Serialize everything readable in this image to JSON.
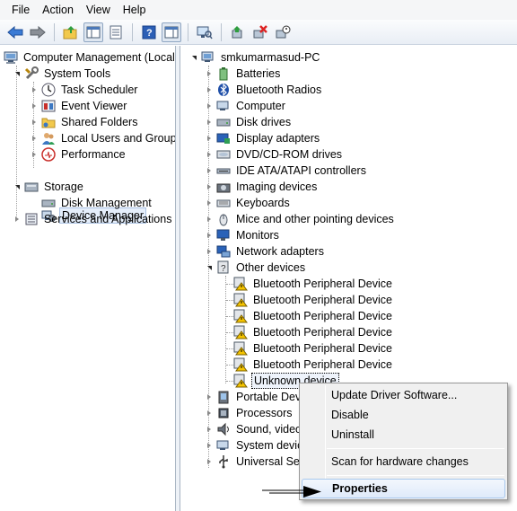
{
  "menu": [
    "File",
    "Action",
    "View",
    "Help"
  ],
  "left_tree": {
    "root": "Computer Management (Local",
    "system_tools": "System Tools",
    "items": [
      "Task Scheduler",
      "Event Viewer",
      "Shared Folders",
      "Local Users and Groups",
      "Performance",
      "Device Manager"
    ],
    "storage": "Storage",
    "disk_management": "Disk Management",
    "services": "Services and Applications"
  },
  "right_tree": {
    "root": "smkumarmasud-PC",
    "categories_top": [
      "Batteries",
      "Bluetooth Radios",
      "Computer",
      "Disk drives",
      "Display adapters",
      "DVD/CD-ROM drives",
      "IDE ATA/ATAPI controllers",
      "Imaging devices",
      "Keyboards",
      "Mice and other pointing devices",
      "Monitors",
      "Network adapters"
    ],
    "other_devices": "Other devices",
    "other_children": [
      "Bluetooth Peripheral Device",
      "Bluetooth Peripheral Device",
      "Bluetooth Peripheral Device",
      "Bluetooth Peripheral Device",
      "Bluetooth Peripheral Device",
      "Bluetooth Peripheral Device"
    ],
    "unknown": "Unknown device",
    "categories_bottom": [
      "Portable Devic",
      "Processors",
      "Sound, video",
      "System device",
      "Universal Seria"
    ]
  },
  "context_menu": {
    "update": "Update Driver Software...",
    "disable": "Disable",
    "uninstall": "Uninstall",
    "scan": "Scan for hardware changes",
    "properties": "Properties"
  }
}
